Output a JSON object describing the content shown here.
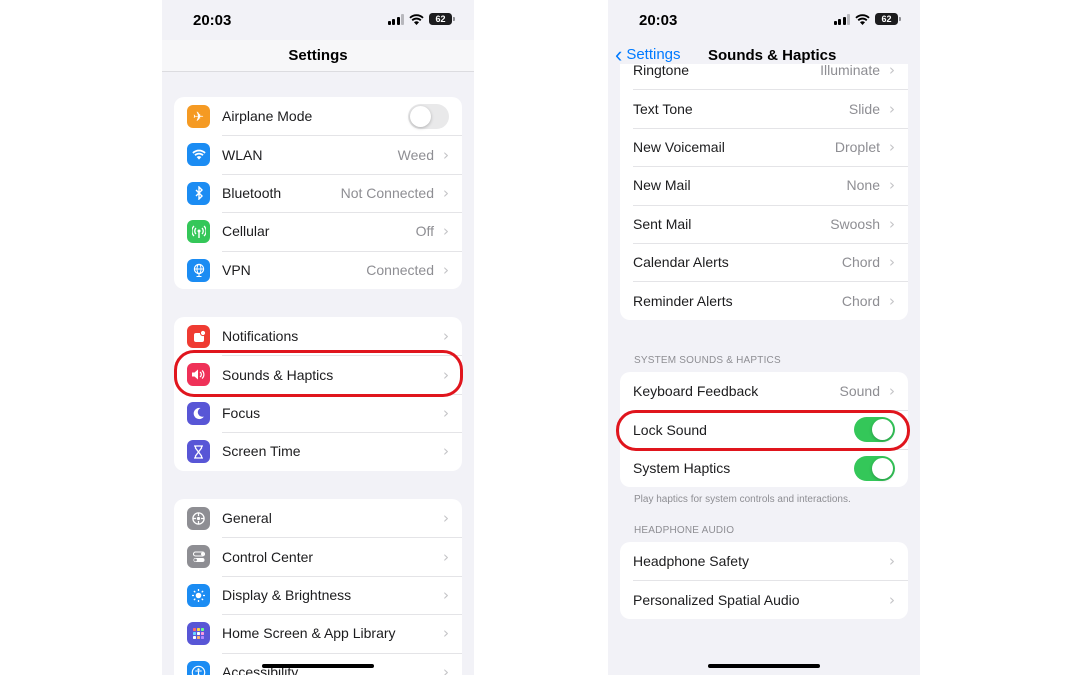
{
  "status_bar": {
    "time": "20:03",
    "battery": "62"
  },
  "left": {
    "title": "Settings",
    "group1": [
      {
        "label": "Airplane Mode",
        "icon": "airplane-icon",
        "color": "#f59a23",
        "toggle": false
      },
      {
        "label": "WLAN",
        "value": "Weed",
        "icon": "wifi-icon",
        "color": "#1b8cf3"
      },
      {
        "label": "Bluetooth",
        "value": "Not Connected",
        "icon": "bluetooth-icon",
        "color": "#1b8cf3"
      },
      {
        "label": "Cellular",
        "value": "Off",
        "icon": "antenna-icon",
        "color": "#34c759"
      },
      {
        "label": "VPN",
        "value": "Connected",
        "icon": "globe-icon",
        "color": "#1b8cf3"
      }
    ],
    "group2": [
      {
        "label": "Notifications",
        "icon": "bell-icon",
        "color": "#ef3b32"
      },
      {
        "label": "Sounds & Haptics",
        "icon": "speaker-icon",
        "color": "#ef3158"
      },
      {
        "label": "Focus",
        "icon": "moon-icon",
        "color": "#5856d6"
      },
      {
        "label": "Screen Time",
        "icon": "hourglass-icon",
        "color": "#5856d6"
      }
    ],
    "group3": [
      {
        "label": "General",
        "icon": "gear-icon",
        "color": "#8e8e93"
      },
      {
        "label": "Control Center",
        "icon": "switches-icon",
        "color": "#8e8e93"
      },
      {
        "label": "Display & Brightness",
        "icon": "sun-icon",
        "color": "#1b8cf3"
      },
      {
        "label": "Home Screen & App Library",
        "icon": "grid-icon",
        "color": "#5856d6"
      },
      {
        "label": "Accessibility",
        "icon": "accessibility-icon",
        "color": "#1b8cf3"
      }
    ]
  },
  "right": {
    "back_label": "Settings",
    "title": "Sounds & Haptics",
    "group1": [
      {
        "label": "Ringtone",
        "value": "Illuminate"
      },
      {
        "label": "Text Tone",
        "value": "Slide"
      },
      {
        "label": "New Voicemail",
        "value": "Droplet"
      },
      {
        "label": "New Mail",
        "value": "None"
      },
      {
        "label": "Sent Mail",
        "value": "Swoosh"
      },
      {
        "label": "Calendar Alerts",
        "value": "Chord"
      },
      {
        "label": "Reminder Alerts",
        "value": "Chord"
      }
    ],
    "system_header": "SYSTEM SOUNDS & HAPTICS",
    "group2": [
      {
        "label": "Keyboard Feedback",
        "value": "Sound"
      },
      {
        "label": "Lock Sound",
        "toggle": true
      },
      {
        "label": "System Haptics",
        "toggle": true
      }
    ],
    "haptics_note": "Play haptics for system controls and interactions.",
    "headphone_header": "HEADPHONE AUDIO",
    "group3": [
      {
        "label": "Headphone Safety"
      },
      {
        "label": "Personalized Spatial Audio"
      }
    ]
  },
  "colors": {
    "highlight": "#e0151d",
    "toggle_on": "#34c759",
    "link": "#007aff"
  }
}
